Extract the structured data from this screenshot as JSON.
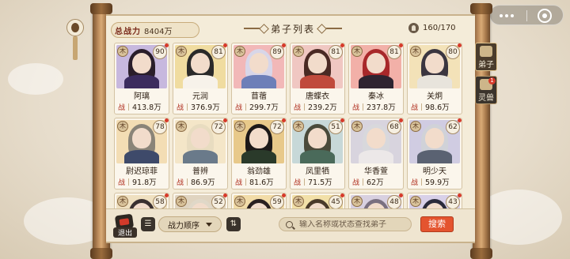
{
  "header": {
    "power_label": "总战力",
    "power_value": "8404万",
    "title": "弟子列表",
    "count": "160/170"
  },
  "tabs": [
    {
      "label": "弟子",
      "icon": "disciple-icon",
      "active": true
    },
    {
      "label": "灵兽",
      "icon": "spirit-beast-icon",
      "badge": "1"
    }
  ],
  "stat_label": "战",
  "disciples": [
    {
      "name": "阿璃",
      "level": "90",
      "power": "413.8万",
      "sect": "木",
      "bg": "#c7b8de",
      "hair": "#2a1e2a",
      "robe": "#3b2c5e"
    },
    {
      "name": "元润",
      "level": "81",
      "power": "376.9万",
      "sect": "木",
      "bg": "#f0dca0",
      "hair": "#2a2a2a",
      "robe": "#f7f2ea"
    },
    {
      "name": "苜蓿",
      "level": "89",
      "power": "299.7万",
      "sect": "木",
      "bg": "#f2b8b8",
      "hair": "#d8d6e8",
      "robe": "#6d7fb8"
    },
    {
      "name": "唐蝶衣",
      "level": "81",
      "power": "239.2万",
      "sect": "木",
      "bg": "#f0c7c2",
      "hair": "#4a2a24",
      "robe": "#c04a3c"
    },
    {
      "name": "秦冰",
      "level": "81",
      "power": "237.8万",
      "sect": "木",
      "bg": "#f2b0a8",
      "hair": "#a8282a",
      "robe": "#2e2430"
    },
    {
      "name": "关炯",
      "level": "80",
      "power": "98.6万",
      "sect": "木",
      "bg": "#f3e2b8",
      "hair": "#3b3640",
      "robe": "#e8e4dc"
    },
    {
      "name": "尉迟琼菲",
      "level": "78",
      "power": "91.8万",
      "sect": "木",
      "bg": "#f3ddb4",
      "hair": "#8a8478",
      "robe": "#3e4a6a"
    },
    {
      "name": "普辨",
      "level": "72",
      "power": "86.9万",
      "sect": "木",
      "bg": "#f4e6c8",
      "hair": "#e8dcc0",
      "robe": "#6a7a8a"
    },
    {
      "name": "翁劲雄",
      "level": "72",
      "power": "81.6万",
      "sect": "木",
      "bg": "#e8c98a",
      "hair": "#1c1818",
      "robe": "#2a3a2a"
    },
    {
      "name": "凤里牺",
      "level": "51",
      "power": "71.5万",
      "sect": "木",
      "bg": "#c7d8d8",
      "hair": "#4a4a3a",
      "robe": "#4a6a5a"
    },
    {
      "name": "华香萱",
      "level": "68",
      "power": "62万",
      "sect": "木",
      "bg": "#d8d4de",
      "hair": "#d8d8dc",
      "robe": "#ece8e8"
    },
    {
      "name": "明少天",
      "level": "62",
      "power": "59.9万",
      "sect": "木",
      "bg": "#d0cce2",
      "hair": "#d0d2d8",
      "robe": "#5a6272"
    },
    {
      "name": "",
      "level": "58",
      "power": "",
      "sect": "木",
      "bg": "#efe0c0",
      "hair": "#3a3030",
      "robe": "#3a3030"
    },
    {
      "name": "",
      "level": "52",
      "power": "",
      "sect": "木",
      "bg": "#e0d4c0",
      "hair": "#e0d8c8",
      "robe": "#8a8a8a"
    },
    {
      "name": "",
      "level": "59",
      "power": "",
      "sect": "木",
      "bg": "#f2dca8",
      "hair": "#2a2020",
      "robe": "#2a2020"
    },
    {
      "name": "",
      "level": "45",
      "power": "",
      "sect": "木",
      "bg": "#f2e0a8",
      "hair": "#4a3a2a",
      "robe": "#4a3a2a"
    },
    {
      "name": "",
      "level": "48",
      "power": "",
      "sect": "木",
      "bg": "#d8d0e0",
      "hair": "#7a7080",
      "robe": "#7a7080"
    },
    {
      "name": "",
      "level": "43",
      "power": "",
      "sect": "木",
      "bg": "#d8d0e8",
      "hair": "#2a2a3a",
      "robe": "#2a2a3a"
    }
  ],
  "bottom": {
    "exit_label": "退出",
    "sort_label": "战力顺序",
    "search_placeholder": "输入名称或状态查找弟子",
    "search_button": "搜索"
  }
}
